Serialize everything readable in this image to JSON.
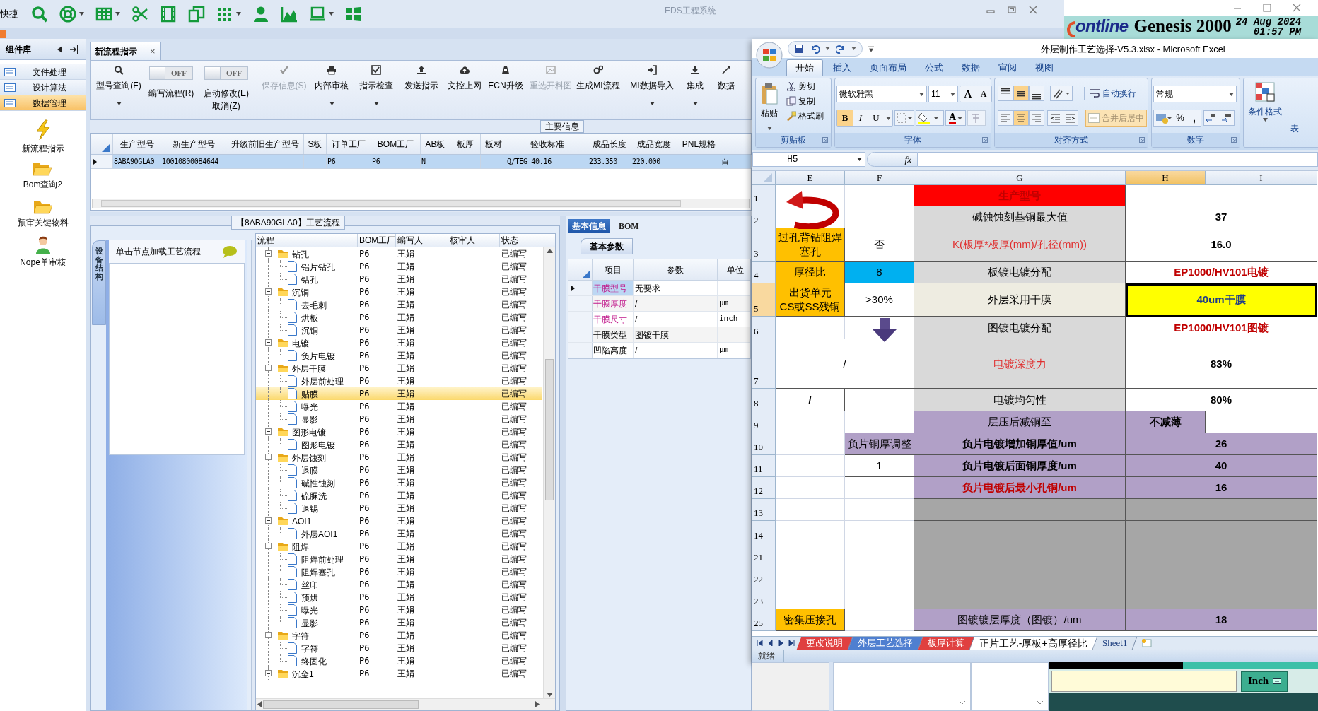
{
  "eds": {
    "quick_label": "快捷",
    "title": "EDS工程系统",
    "sidebar": {
      "title": "组件库",
      "categories": [
        {
          "label": "文件处理",
          "selected": false
        },
        {
          "label": "设计算法",
          "selected": false
        },
        {
          "label": "数据管理",
          "selected": true
        }
      ],
      "tools": [
        {
          "label": "新流程指示",
          "kind": "bolt"
        },
        {
          "label": "Bom查询2",
          "kind": "folder"
        },
        {
          "label": "预审关键物料",
          "kind": "folder"
        },
        {
          "label": "Nope单审核",
          "kind": "user"
        }
      ]
    },
    "document_tab": {
      "label": "新流程指示",
      "close": "×"
    },
    "ribbon": [
      {
        "kind": "button",
        "label": "型号查询(F)",
        "dropdown": true,
        "disabled": false
      },
      {
        "kind": "toggle",
        "label": "编写流程(R)",
        "switch_text": "OFF",
        "on": false
      },
      {
        "kind": "toggle",
        "label": "启动修改(E)",
        "sub_label": "取消(Z)",
        "switch_text": "OFF",
        "on": false
      },
      {
        "kind": "button",
        "label": "保存信息(S)",
        "dropdown": false,
        "disabled": true
      },
      {
        "kind": "button",
        "label": "内部审核",
        "dropdown": true,
        "disabled": false
      },
      {
        "kind": "button",
        "label": "指示检查",
        "dropdown": true,
        "disabled": false
      },
      {
        "kind": "button",
        "label": "发送指示",
        "dropdown": false,
        "disabled": false
      },
      {
        "kind": "button",
        "label": "文控上网",
        "dropdown": false,
        "disabled": false
      },
      {
        "kind": "button",
        "label": "ECN升级",
        "dropdown": false,
        "disabled": false
      },
      {
        "kind": "button",
        "label": "重选开料图",
        "dropdown": false,
        "disabled": true
      },
      {
        "kind": "button",
        "label": "生成MI流程",
        "dropdown": false,
        "disabled": false
      },
      {
        "kind": "button",
        "label": "MI数据导入",
        "dropdown": true,
        "disabled": false
      },
      {
        "kind": "button",
        "label": "集成",
        "dropdown": true,
        "disabled": false
      },
      {
        "kind": "button",
        "label": "数据",
        "dropdown": false,
        "disabled": false
      }
    ],
    "main_info": {
      "legend": "主要信息",
      "columns": [
        "生产型号",
        "新生产型号",
        "升级前旧生产型号",
        "S板",
        "订单工厂",
        "BOM工厂",
        "AB板",
        "板厚",
        "板材",
        "验收标准",
        "成品长度",
        "成品宽度",
        "PNL规格"
      ],
      "rows": [
        {
          "selected": true,
          "cells": [
            "8ABA90GLA0",
            "10010800084644",
            null,
            null,
            "P6",
            "P6",
            "N",
            null,
            null,
            "Q/TEG 40.16",
            "233.350",
            "220.000",
            null,
            "白"
          ]
        }
      ]
    },
    "process_flow": {
      "title": "【8ABA90GLA0】工艺流程",
      "side_tab": "设备结构",
      "hint": "单击节点加载工艺流程",
      "columns": [
        "流程",
        "BOM工厂",
        "编写人",
        "核审人",
        "状态"
      ],
      "tree": [
        {
          "label": "钻孔",
          "factory": "P6",
          "writer": "王娟",
          "status": "已编写",
          "expanded": true,
          "selected": false,
          "children": [
            {
              "label": "铝片钻孔",
              "factory": "P6",
              "writer": "王娟",
              "status": "已编写",
              "selected": false
            },
            {
              "label": "钻孔",
              "factory": "P6",
              "writer": "王娟",
              "status": "已编写",
              "selected": false
            }
          ]
        },
        {
          "label": "沉铜",
          "factory": "P6",
          "writer": "王娟",
          "status": "已编写",
          "expanded": true,
          "selected": false,
          "children": [
            {
              "label": "去毛刺",
              "factory": "P6",
              "writer": "王娟",
              "status": "已编写",
              "selected": false
            },
            {
              "label": "烘板",
              "factory": "P6",
              "writer": "王娟",
              "status": "已编写",
              "selected": false
            },
            {
              "label": "沉铜",
              "factory": "P6",
              "writer": "王娟",
              "status": "已编写",
              "selected": false
            }
          ]
        },
        {
          "label": "电镀",
          "factory": "P6",
          "writer": "王娟",
          "status": "已编写",
          "expanded": true,
          "selected": false,
          "children": [
            {
              "label": "负片电镀",
              "factory": "P6",
              "writer": "王娟",
              "status": "已编写",
              "selected": false
            }
          ]
        },
        {
          "label": "外层干膜",
          "factory": "P6",
          "writer": "王娟",
          "status": "已编写",
          "expanded": true,
          "selected": false,
          "children": [
            {
              "label": "外层前处理",
              "factory": "P6",
              "writer": "王娟",
              "status": "已编写",
              "selected": false
            },
            {
              "label": "贴膜",
              "factory": "P6",
              "writer": "王娟",
              "status": "已编写",
              "selected": true
            },
            {
              "label": "曝光",
              "factory": "P6",
              "writer": "王娟",
              "status": "已编写",
              "selected": false
            },
            {
              "label": "显影",
              "factory": "P6",
              "writer": "王娟",
              "status": "已编写",
              "selected": false
            }
          ]
        },
        {
          "label": "图形电镀",
          "factory": "P6",
          "writer": "王娟",
          "status": "已编写",
          "expanded": true,
          "selected": false,
          "children": [
            {
              "label": "图形电镀",
              "factory": "P6",
              "writer": "王娟",
              "status": "已编写",
              "selected": false
            }
          ]
        },
        {
          "label": "外层蚀刻",
          "factory": "P6",
          "writer": "王娟",
          "status": "已编写",
          "expanded": true,
          "selected": false,
          "children": [
            {
              "label": "退膜",
              "factory": "P6",
              "writer": "王娟",
              "status": "已编写",
              "selected": false
            },
            {
              "label": "碱性蚀刻",
              "factory": "P6",
              "writer": "王娟",
              "status": "已编写",
              "selected": false
            },
            {
              "label": "硫脲洗",
              "factory": "P6",
              "writer": "王娟",
              "status": "已编写",
              "selected": false
            },
            {
              "label": "退锡",
              "factory": "P6",
              "writer": "王娟",
              "status": "已编写",
              "selected": false
            }
          ]
        },
        {
          "label": "AOI1",
          "factory": "P6",
          "writer": "王娟",
          "status": "已编写",
          "expanded": true,
          "selected": false,
          "children": [
            {
              "label": "外层AOI1",
              "factory": "P6",
              "writer": "王娟",
              "status": "已编写",
              "selected": false
            }
          ]
        },
        {
          "label": "阻焊",
          "factory": "P6",
          "writer": "王娟",
          "status": "已编写",
          "expanded": true,
          "selected": false,
          "children": [
            {
              "label": "阻焊前处理",
              "factory": "P6",
              "writer": "王娟",
              "status": "已编写",
              "selected": false
            },
            {
              "label": "阻焊塞孔",
              "factory": "P6",
              "writer": "王娟",
              "status": "已编写",
              "selected": false
            },
            {
              "label": "丝印",
              "factory": "P6",
              "writer": "王娟",
              "status": "已编写",
              "selected": false
            },
            {
              "label": "预烘",
              "factory": "P6",
              "writer": "王娟",
              "status": "已编写",
              "selected": false
            },
            {
              "label": "曝光",
              "factory": "P6",
              "writer": "王娟",
              "status": "已编写",
              "selected": false
            },
            {
              "label": "显影",
              "factory": "P6",
              "writer": "王娟",
              "status": "已编写",
              "selected": false
            }
          ]
        },
        {
          "label": "字符",
          "factory": "P6",
          "writer": "王娟",
          "status": "已编写",
          "expanded": true,
          "selected": false,
          "children": [
            {
              "label": "字符",
              "factory": "P6",
              "writer": "王娟",
              "status": "已编写",
              "selected": false
            },
            {
              "label": "终固化",
              "factory": "P6",
              "writer": "王娟",
              "status": "已编写",
              "selected": false
            }
          ]
        },
        {
          "label": "沉金1",
          "factory": "P6",
          "writer": "王娟",
          "status": "已编写",
          "expanded": true,
          "selected": false
        }
      ]
    },
    "detail": {
      "tabs": [
        {
          "label": "基本信息",
          "selected": true
        },
        {
          "label": "BOM",
          "selected": false
        }
      ],
      "subtab": "基本参数",
      "columns": [
        "项目",
        "参数",
        "单位"
      ],
      "rows": [
        {
          "item": "干膜型号",
          "value": "无要求",
          "unit": null,
          "required": true,
          "selected": true
        },
        {
          "item": "干膜厚度",
          "value": "/",
          "unit": "μm",
          "required": true,
          "selected": false
        },
        {
          "item": "干膜尺寸",
          "value": "/",
          "unit": "inch",
          "required": true,
          "selected": false
        },
        {
          "item": "干膜类型",
          "value": "图镀干膜",
          "unit": null,
          "required": false,
          "selected": false
        },
        {
          "item": "凹陷高度",
          "value": "/",
          "unit": "μm",
          "required": false,
          "selected": false
        }
      ]
    }
  },
  "genesis": {
    "logo": "ontline",
    "title": "Genesis 2000",
    "date": "24 Aug 2024",
    "time": "01:57 PM",
    "unit_button": "Inch"
  },
  "excel": {
    "title": "外层制作工艺选择-V5.3.xlsx - Microsoft Excel",
    "tabs": [
      {
        "label": "开始",
        "selected": true
      },
      {
        "label": "插入",
        "selected": false
      },
      {
        "label": "页面布局",
        "selected": false
      },
      {
        "label": "公式",
        "selected": false
      },
      {
        "label": "数据",
        "selected": false
      },
      {
        "label": "审阅",
        "selected": false
      },
      {
        "label": "视图",
        "selected": false
      }
    ],
    "clipboard": {
      "paste": "粘贴",
      "cut": "剪切",
      "copy": "复制",
      "painter": "格式刷",
      "group": "剪贴板"
    },
    "font": {
      "name": "微软雅黑",
      "size": "11",
      "grow": "A",
      "shrink": "A",
      "bold": "B",
      "italic": "I",
      "underline": "U",
      "font_color_letter": "A",
      "group": "字体"
    },
    "alignment": {
      "wrap": "自动换行",
      "merge": "合并后居中",
      "group": "对齐方式"
    },
    "number": {
      "format": "常规",
      "percent": "%",
      "comma": ",",
      "group": "数字"
    },
    "styles": {
      "conditional": "条件格式",
      "cut": "表"
    },
    "name_box": "H5",
    "fx": "fx",
    "columns": [
      {
        "label": "E",
        "selected": false
      },
      {
        "label": "F",
        "selected": false
      },
      {
        "label": "G",
        "selected": false
      },
      {
        "label": "H",
        "selected": true
      },
      {
        "label": "I",
        "selected": false
      }
    ],
    "rows": [
      {
        "number": "1",
        "selected": false,
        "cells": {
          "G": {
            "text": "生产型号",
            "color": "#ff0000",
            "warning": true,
            "bold": true
          },
          "H": {
            "color": "#ffffff",
            "merged": true
          }
        }
      },
      {
        "number": "2",
        "selected": false,
        "cells": {
          "G": {
            "text": "碱蚀蚀刻基铜最大值",
            "color": "#d9d9d9",
            "warning": false,
            "bold": false
          },
          "H": {
            "text": "37",
            "color": "#ffffff",
            "warning": false,
            "bold": true,
            "merged": true
          }
        }
      },
      {
        "number": "3",
        "selected": false,
        "cells": {
          "E": {
            "text": "过孔背钻阻焊塞孔",
            "color": "#ffc000",
            "warning": false,
            "bold": false
          },
          "F": {
            "text": "否",
            "color": "#ffffff",
            "warning": false,
            "bold": false
          },
          "G": {
            "text": "K(板厚*板厚(mm)/孔径(mm))",
            "color": "#d9d9d9",
            "warning": true,
            "bold": false
          },
          "H": {
            "text": "16.0",
            "color": "#ffffff",
            "warning": false,
            "bold": true,
            "merged": true
          }
        }
      },
      {
        "number": "4",
        "selected": false,
        "cells": {
          "E": {
            "text": "厚径比",
            "color": "#ffc000",
            "warning": false,
            "bold": false
          },
          "F": {
            "text": "8",
            "color": "#00b0f0",
            "warning": false,
            "bold": false
          },
          "G": {
            "text": "板镀电镀分配",
            "color": "#d9d9d9",
            "warning": false,
            "bold": false
          },
          "H": {
            "text": "EP1000/HV101电镀",
            "color": "#ffffff",
            "warning": true,
            "bold": true,
            "merged": true
          }
        }
      },
      {
        "number": "5",
        "selected": true,
        "cells": {
          "E": {
            "lines": [
              "出货单元",
              "CS或SS残铜"
            ],
            "color": "#ffc000",
            "warning": false,
            "bold": false
          },
          "F": {
            "text": ">30%",
            "color": "#ffffff",
            "warning": false,
            "bold": false
          },
          "G": {
            "text": "外层采用干膜",
            "color": "#eeece1",
            "warning": false,
            "bold": false
          },
          "H": {
            "text": "40um干膜",
            "color": "#ffff00",
            "warning": false,
            "accent": true,
            "bold": true,
            "merged": true
          }
        }
      },
      {
        "number": "6",
        "selected": false,
        "cells": {
          "G": {
            "text": "图镀电镀分配",
            "color": "#d9d9d9",
            "warning": false,
            "bold": false
          },
          "H": {
            "text": "EP1000/HV101图镀",
            "color": "#ffffff",
            "warning": true,
            "bold": true,
            "merged": true
          }
        }
      },
      {
        "number": "7",
        "selected": false,
        "cells": {
          "E": {
            "text": "/",
            "color": "#ffffff",
            "warning": false,
            "bold": false,
            "merged": true
          },
          "G": {
            "text": "电镀深度力",
            "color": "#d9d9d9",
            "warning": true,
            "bold": false
          },
          "H": {
            "text": "83%",
            "color": "#ffffff",
            "warning": false,
            "bold": true,
            "merged": true
          }
        }
      },
      {
        "number": "8",
        "selected": false,
        "cells": {
          "E": {
            "text": "/",
            "color": "#ffffff",
            "warning": false,
            "bold": true
          },
          "G": {
            "text": "电镀均匀性",
            "color": "#d9d9d9",
            "warning": false,
            "bold": false
          },
          "H": {
            "text": "80%",
            "color": "#ffffff",
            "warning": false,
            "bold": true,
            "merged": true
          }
        }
      },
      {
        "number": "9",
        "selected": false,
        "cells": {
          "G": {
            "text": "层压后减铜至",
            "color": "#b1a0c7",
            "warning": false,
            "bold": false
          },
          "H": {
            "text": "不减薄",
            "color": "#b1a0c7",
            "warning": false,
            "bold": true,
            "merged": false
          }
        }
      },
      {
        "number": "10",
        "selected": false,
        "cells": {
          "F": {
            "text": "负片铜厚调整",
            "color": "#b1a0c7",
            "warning": false,
            "bold": false
          },
          "G": {
            "text": "负片电镀增加铜厚值/um",
            "color": "#b1a0c7",
            "warning": false,
            "bold": true
          },
          "H": {
            "text": "26",
            "color": "#b1a0c7",
            "warning": false,
            "bold": true,
            "merged": true
          }
        }
      },
      {
        "number": "11",
        "selected": false,
        "cells": {
          "F": {
            "text": "1",
            "color": "#ffffff",
            "warning": false,
            "bold": false
          },
          "G": {
            "text": "负片电镀后面铜厚度/um",
            "color": "#b1a0c7",
            "warning": false,
            "bold": true
          },
          "H": {
            "text": "40",
            "color": "#b1a0c7",
            "warning": false,
            "bold": true,
            "merged": true
          }
        }
      },
      {
        "number": "12",
        "selected": false,
        "cells": {
          "G": {
            "text": "负片电镀后最小孔铜/um",
            "color": "#b1a0c7",
            "warning": true,
            "bold": true
          },
          "H": {
            "text": "16",
            "color": "#b1a0c7",
            "warning": false,
            "bold": true,
            "merged": true
          }
        }
      },
      {
        "number": "13",
        "selected": false,
        "cells": {
          "G": {
            "color": "#a6a6a6"
          },
          "H": {
            "color": "#a6a6a6",
            "merged": true
          }
        }
      },
      {
        "number": "14",
        "selected": false,
        "cells": {
          "G": {
            "color": "#a6a6a6"
          },
          "H": {
            "color": "#a6a6a6",
            "merged": true
          }
        }
      },
      {
        "number": "21",
        "selected": false,
        "cells": {
          "G": {
            "color": "#a6a6a6"
          },
          "H": {
            "color": "#a6a6a6",
            "merged": true
          }
        }
      },
      {
        "number": "22",
        "selected": false,
        "cells": {
          "G": {
            "color": "#a6a6a6"
          },
          "H": {
            "color": "#a6a6a6",
            "merged": true
          }
        }
      },
      {
        "number": "23",
        "selected": false,
        "cells": {
          "G": {
            "color": "#a6a6a6"
          },
          "H": {
            "color": "#a6a6a6",
            "merged": true
          }
        }
      },
      {
        "number": "25",
        "selected": false,
        "cells": {
          "E": {
            "text": "密集压接孔",
            "color": "#ffc000",
            "warning": false,
            "bold": false
          },
          "G": {
            "text": "图镀镀层厚度（图镀）/um",
            "color": "#b1a0c7",
            "warning": false,
            "bold": false
          },
          "H": {
            "text": "18",
            "color": "#b1a0c7",
            "warning": false,
            "bold": true,
            "merged": true
          }
        }
      }
    ],
    "sheets": [
      {
        "label": "更改说明",
        "selected": false,
        "color": "#e04040"
      },
      {
        "label": "外层工艺选择",
        "selected": false,
        "color": "#4f7fd0"
      },
      {
        "label": "板厚计算",
        "selected": false,
        "color": "#e04040"
      },
      {
        "label": "正片工艺-厚板+高厚径比",
        "selected": true,
        "color": "#ffffff"
      },
      {
        "label": "Sheet1",
        "selected": false,
        "color": "#dbe5f1"
      }
    ],
    "status": "就绪"
  }
}
